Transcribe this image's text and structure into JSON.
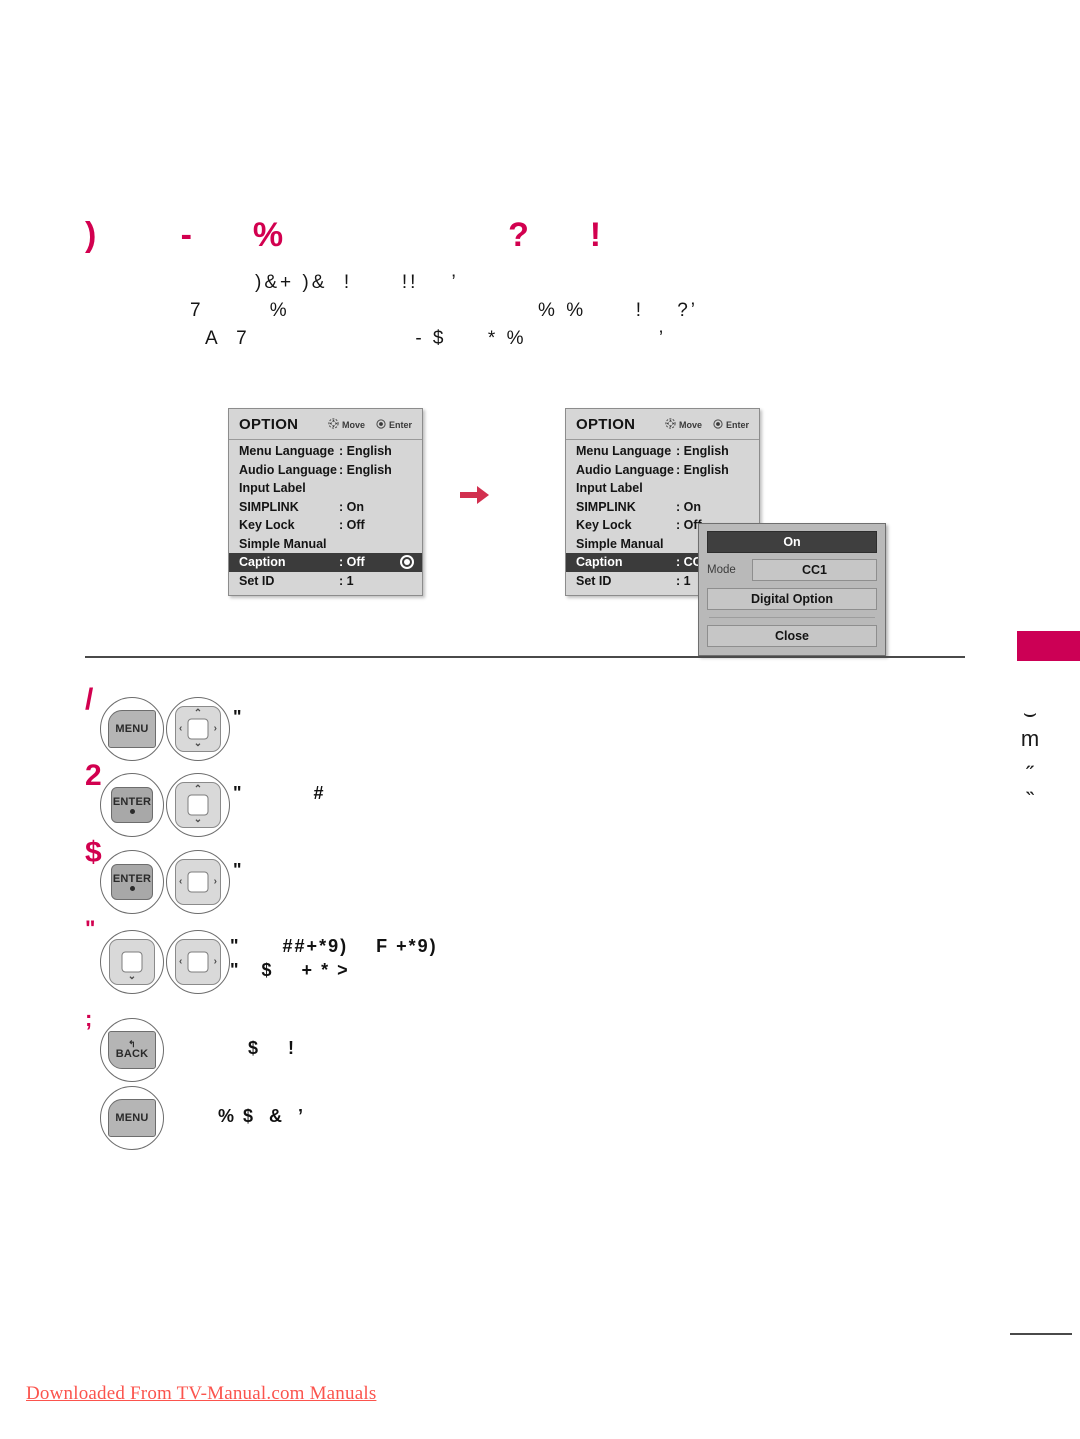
{
  "page": {
    "title": ")   -  %         ?  !",
    "intro_lines": [
      ")&+ )&  !      !!    ’",
      "7        %                              % %      !    ?’",
      "A  7                    - $     * %                ’"
    ]
  },
  "osd_left": {
    "title": "OPTION",
    "hints": [
      {
        "icon": "dpad-move-icon",
        "label": "Move"
      },
      {
        "icon": "enter-dot-icon",
        "label": "Enter"
      }
    ],
    "rows": [
      {
        "label": "Menu Language",
        "value": ": English",
        "selected": false,
        "radio": false
      },
      {
        "label": "Audio Language",
        "value": ": English",
        "selected": false,
        "radio": false
      },
      {
        "label": "Input Label",
        "value": "",
        "selected": false,
        "radio": false
      },
      {
        "label": "SIMPLINK",
        "value": ": On",
        "selected": false,
        "radio": false
      },
      {
        "label": "Key Lock",
        "value": ": Off",
        "selected": false,
        "radio": false
      },
      {
        "label": "Simple Manual",
        "value": "",
        "selected": false,
        "radio": false
      },
      {
        "label": "Caption",
        "value": ": Off",
        "selected": true,
        "radio": true
      },
      {
        "label": "Set ID",
        "value": ": 1",
        "selected": false,
        "radio": false
      }
    ]
  },
  "osd_right": {
    "title": "OPTION",
    "hints": [
      {
        "icon": "dpad-move-icon",
        "label": "Move"
      },
      {
        "icon": "enter-dot-icon",
        "label": "Enter"
      }
    ],
    "rows": [
      {
        "label": "Menu Language",
        "value": ": English",
        "selected": false,
        "radio": false
      },
      {
        "label": "Audio Language",
        "value": ": English",
        "selected": false,
        "radio": false
      },
      {
        "label": "Input Label",
        "value": "",
        "selected": false,
        "radio": false
      },
      {
        "label": "SIMPLINK",
        "value": ": On",
        "selected": false,
        "radio": false
      },
      {
        "label": "Key Lock",
        "value": ": Off",
        "selected": false,
        "radio": false
      },
      {
        "label": "Simple Manual",
        "value": "",
        "selected": false,
        "radio": false
      },
      {
        "label": "Caption",
        "value": ": CC",
        "selected": true,
        "radio": false
      },
      {
        "label": "Set ID",
        "value": ": 1",
        "selected": false,
        "radio": false
      }
    ]
  },
  "caption_popup": {
    "on_label": "On",
    "mode_label": "Mode",
    "mode_value": "CC1",
    "digital_option_label": "Digital Option",
    "close_label": "Close"
  },
  "steps": [
    {
      "number": "/",
      "keys": [
        "menu-button",
        "dpad-updown-leftright"
      ],
      "key_labels": {
        "menu": "MENU"
      },
      "text_lines": [
        "\""
      ]
    },
    {
      "number": "2",
      "keys": [
        "enter-button",
        "dpad-updown"
      ],
      "key_labels": {
        "enter": "ENTER"
      },
      "text_lines": [
        "\"          #"
      ]
    },
    {
      "number": "$",
      "keys": [
        "enter-button",
        "dpad-leftright"
      ],
      "key_labels": {
        "enter": "ENTER"
      },
      "text_lines": [
        "\""
      ]
    },
    {
      "number": "\"",
      "keys": [
        "dpad-down",
        "dpad-leftright"
      ],
      "key_labels": {},
      "text_lines": [
        "\"      ##+*9)    F +*9)",
        "\"   $    + * >"
      ]
    },
    {
      "number": ";",
      "keys": [
        "back-button",
        "menu-button"
      ],
      "key_labels": {
        "back": "BACK",
        "menu": "MENU"
      },
      "text_lines": [
        "$    !",
        "% $  &  ’"
      ]
    }
  ],
  "margin": {
    "tab_color": "#cc0055",
    "vertical_text": "⌣\nm\n˶\n˵"
  },
  "footer": {
    "link_text": "Downloaded From TV-Manual.com Manuals"
  }
}
